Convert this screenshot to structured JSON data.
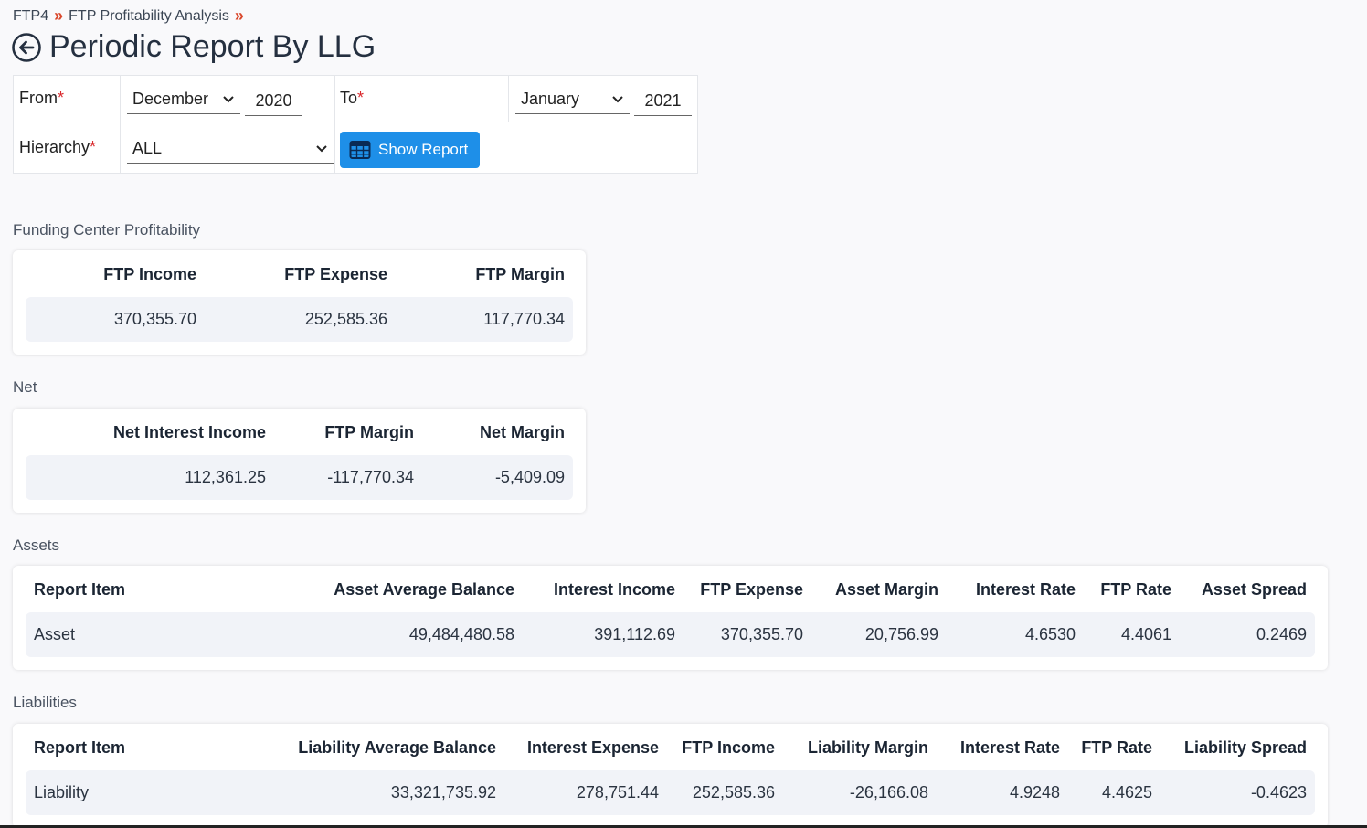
{
  "breadcrumb": {
    "item1": "FTP4",
    "item2": "FTP Profitability Analysis",
    "separator": "»"
  },
  "page": {
    "title": "Periodic Report By LLG"
  },
  "filters": {
    "from_label": "From",
    "to_label": "To",
    "hierarchy_label": "Hierarchy",
    "required_mark": "*",
    "from_month": "December",
    "from_year": "2020",
    "to_month": "January",
    "to_year": "2021",
    "hierarchy_value": "ALL",
    "show_report_label": "Show Report"
  },
  "funding": {
    "title": "Funding Center Profitability",
    "headers": [
      "FTP Income",
      "FTP Expense",
      "FTP Margin"
    ],
    "values": [
      "370,355.70",
      "252,585.36",
      "117,770.34"
    ]
  },
  "net": {
    "title": "Net",
    "headers": [
      "Net Interest Income",
      "FTP Margin",
      "Net Margin"
    ],
    "values": [
      "112,361.25",
      "-117,770.34",
      "-5,409.09"
    ]
  },
  "assets": {
    "title": "Assets",
    "headers": [
      "Report Item",
      "Asset Average Balance",
      "Interest Income",
      "FTP Expense",
      "Asset Margin",
      "Interest Rate",
      "FTP Rate",
      "Asset Spread"
    ],
    "row": [
      "Asset",
      "49,484,480.58",
      "391,112.69",
      "370,355.70",
      "20,756.99",
      "4.6530",
      "4.4061",
      "0.2469"
    ]
  },
  "liabilities": {
    "title": "Liabilities",
    "headers": [
      "Report Item",
      "Liability Average Balance",
      "Interest Expense",
      "FTP Income",
      "Liability Margin",
      "Interest Rate",
      "FTP Rate",
      "Liability Spread"
    ],
    "row": [
      "Liability",
      "33,321,735.92",
      "278,751.44",
      "252,585.36",
      "-26,166.08",
      "4.9248",
      "4.4625",
      "-0.4623"
    ]
  },
  "colors": {
    "accent": "#1e8fe8",
    "breadcrumb_sep": "#d9472b",
    "required": "#d9272b",
    "row_bg": "#f1f3f8"
  }
}
